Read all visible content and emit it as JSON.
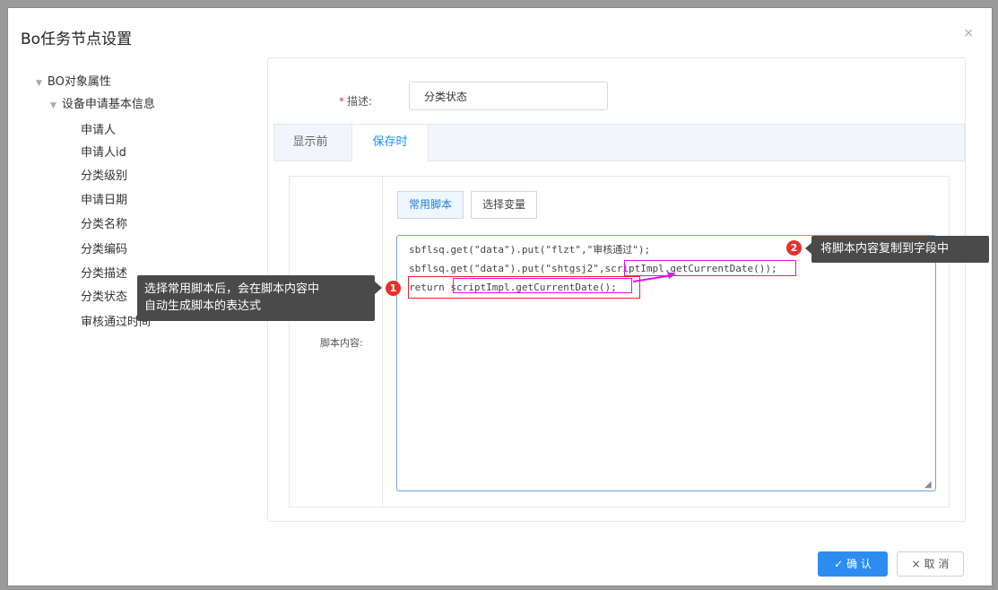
{
  "dialog": {
    "title": "Bo任务节点设置",
    "close_icon": "×"
  },
  "tree": {
    "root": "BO对象属性",
    "group": "设备申请基本信息",
    "fields": [
      "申请人",
      "申请人id",
      "分类级别",
      "申请日期",
      "分类名称",
      "分类编码",
      "分类描述",
      "分类状态",
      "审核通过时间"
    ]
  },
  "form": {
    "desc_required": "*",
    "desc_label": "描述:",
    "desc_value": "分类状态",
    "tabs": [
      "显示前",
      "保存时"
    ],
    "active_tab": "保存时",
    "script_tabs": [
      "常用脚本",
      "选择变量"
    ],
    "script_label": "脚本内容:",
    "code_lines": [
      "sbflsq.get(\"data\").put(\"flzt\",\"审核通过\");",
      "sbflsq.get(\"data\").put(\"shtgsj2\",scriptImpl.getCurrentDate());",
      "return scriptImpl.getCurrentDate();"
    ]
  },
  "annotations": {
    "badge1": "1",
    "badge2": "2",
    "tip1_line1": "选择常用脚本后，会在脚本内容中",
    "tip1_line2": "自动生成脚本的表达式",
    "tip2": "将脚本内容复制到字段中"
  },
  "footer": {
    "ok_label": "✓ 确 认",
    "cancel_label": "× 取 消"
  },
  "colors": {
    "accent": "#2d8cf0",
    "highlight_magenta": "#e60fe6",
    "highlight_red": "#e8242f"
  }
}
